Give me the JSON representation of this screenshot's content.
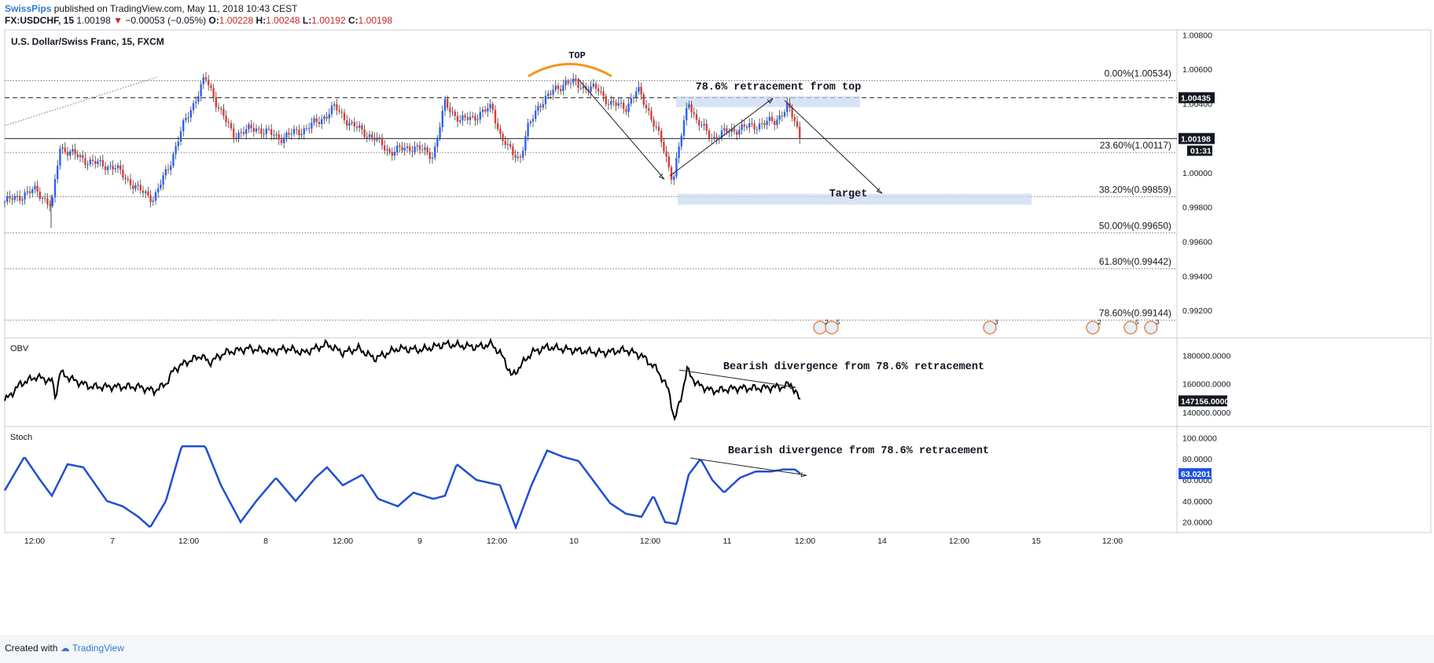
{
  "header": {
    "publisher": "SwissPips",
    "published_text": "published on TradingView.com, May 11, 2018 10:43 CEST",
    "symbol": "FX:USDCHF, 15",
    "last": "1.00198",
    "change": "−0.00053 (−0.05%)",
    "ohlc_label_o": "O:",
    "ohlc_o": "1.00228",
    "ohlc_label_h": "H:",
    "ohlc_h": "1.00248",
    "ohlc_label_l": "L:",
    "ohlc_l": "1.00192",
    "ohlc_label_c": "C:",
    "ohlc_c": "1.00198"
  },
  "footer": {
    "created_with": "Created with",
    "brand": "TradingView"
  },
  "colors": {
    "up": "#2962ff",
    "down": "#e53935",
    "obv": "#000000",
    "stoch": "#1f4fd1",
    "zone": "#c8d7f0",
    "top_arc": "#f7931e"
  },
  "chart_data": [
    {
      "type": "candlestick",
      "title": "U.S. Dollar/Swiss Franc, 15, FXCM",
      "ylim": [
        0.9905,
        1.0082
      ],
      "y_ticks": [
        "1.00800",
        "1.00600",
        "1.00400",
        "1.00200",
        "1.00000",
        "0.99800",
        "0.99600",
        "0.99400",
        "0.99200"
      ],
      "x_tick_labels": [
        "12:00",
        "7",
        "12:00",
        "8",
        "12:00",
        "9",
        "12:00",
        "10",
        "12:00",
        "11",
        "12:00",
        "14",
        "12:00",
        "15",
        "12:00"
      ],
      "price_path": [
        [
          0,
          0.9983
        ],
        [
          40,
          0.999
        ],
        [
          60,
          0.998
        ],
        [
          70,
          1.0015
        ],
        [
          90,
          1.001
        ],
        [
          110,
          1.0006
        ],
        [
          140,
          1.0003
        ],
        [
          170,
          0.999
        ],
        [
          190,
          0.9985
        ],
        [
          210,
          1.0005
        ],
        [
          225,
          1.0025
        ],
        [
          240,
          1.004
        ],
        [
          255,
          1.0055
        ],
        [
          270,
          1.004
        ],
        [
          290,
          1.0022
        ],
        [
          320,
          1.0026
        ],
        [
          350,
          1.002
        ],
        [
          380,
          1.0025
        ],
        [
          400,
          1.003
        ],
        [
          420,
          1.0038
        ],
        [
          440,
          1.0028
        ],
        [
          470,
          1.002
        ],
        [
          490,
          1.0012
        ],
        [
          520,
          1.0015
        ],
        [
          545,
          1.001
        ],
        [
          560,
          1.004
        ],
        [
          580,
          1.003
        ],
        [
          600,
          1.0033
        ],
        [
          620,
          1.0038
        ],
        [
          630,
          1.0022
        ],
        [
          640,
          1.0014
        ],
        [
          655,
          1.0008
        ],
        [
          665,
          1.0025
        ],
        [
          680,
          1.004
        ],
        [
          700,
          1.0048
        ],
        [
          715,
          1.0053
        ],
        [
          735,
          1.005
        ],
        [
          755,
          1.0048
        ],
        [
          770,
          1.004
        ],
        [
          790,
          1.0038
        ],
        [
          805,
          1.0048
        ],
        [
          820,
          1.0035
        ],
        [
          835,
          1.0018
        ],
        [
          850,
          0.9996
        ],
        [
          860,
          1.002
        ],
        [
          870,
          1.0042
        ],
        [
          880,
          1.003
        ],
        [
          900,
          1.002
        ],
        [
          920,
          1.0024
        ],
        [
          940,
          1.0026
        ],
        [
          960,
          1.0028
        ],
        [
          980,
          1.003
        ],
        [
          995,
          1.0038
        ],
        [
          1005,
          1.003
        ],
        [
          1012,
          1.002
        ]
      ],
      "last_price": "1.00198",
      "countdown": "01:31",
      "marked_level": "1.00435",
      "fibonacci": [
        {
          "label": "0.00%(1.00534)",
          "value": 1.00534
        },
        {
          "label": "23.60%(1.00117)",
          "value": 1.00117
        },
        {
          "label": "38.20%(0.99859)",
          "value": 0.99859
        },
        {
          "label": "50.00%(0.99650)",
          "value": 0.9965
        },
        {
          "label": "61.80%(0.99442)",
          "value": 0.99442
        },
        {
          "label": "78.60%(0.99144)",
          "value": 0.99144
        }
      ],
      "annotations": {
        "top": "TOP",
        "retracement": "78.6% retracement from top",
        "target": "Target"
      },
      "event_badges": [
        "2",
        "5",
        "3",
        "2",
        "5",
        "3"
      ]
    },
    {
      "type": "line",
      "title": "OBV",
      "ylim": [
        131000,
        192000
      ],
      "y_ticks": [
        "180000.0000",
        "160000.0000",
        "140000.0000"
      ],
      "series": [
        {
          "name": "OBV",
          "points": [
            [
              0,
              148000
            ],
            [
              20,
              160000
            ],
            [
              40,
              165000
            ],
            [
              60,
              162000
            ],
            [
              65,
              150000
            ],
            [
              70,
              168000
            ],
            [
              90,
              162000
            ],
            [
              110,
              158000
            ],
            [
              140,
              158000
            ],
            [
              170,
              158000
            ],
            [
              190,
              155000
            ],
            [
              205,
              160000
            ],
            [
              215,
              170000
            ],
            [
              230,
              175000
            ],
            [
              250,
              180000
            ],
            [
              260,
              175000
            ],
            [
              280,
              182000
            ],
            [
              310,
              185000
            ],
            [
              340,
              183000
            ],
            [
              360,
              185000
            ],
            [
              380,
              182000
            ],
            [
              410,
              188000
            ],
            [
              430,
              182000
            ],
            [
              450,
              185000
            ],
            [
              470,
              178000
            ],
            [
              480,
              180000
            ],
            [
              500,
              185000
            ],
            [
              530,
              184000
            ],
            [
              560,
              188000
            ],
            [
              600,
              186000
            ],
            [
              620,
              188000
            ],
            [
              635,
              178000
            ],
            [
              645,
              165000
            ],
            [
              655,
              172000
            ],
            [
              670,
              182000
            ],
            [
              690,
              186000
            ],
            [
              720,
              184000
            ],
            [
              760,
              182000
            ],
            [
              790,
              184000
            ],
            [
              810,
              180000
            ],
            [
              830,
              170000
            ],
            [
              845,
              155000
            ],
            [
              852,
              134000
            ],
            [
              860,
              150000
            ],
            [
              868,
              170000
            ],
            [
              880,
              160000
            ],
            [
              900,
              155000
            ],
            [
              930,
              157000
            ],
            [
              960,
              157000
            ],
            [
              990,
              158000
            ],
            [
              1000,
              160000
            ],
            [
              1012,
              148000
            ]
          ]
        }
      ],
      "last_value": "147156.0000",
      "annotation": "Bearish divergence from 78.6% retracement"
    },
    {
      "type": "line",
      "title": "Stoch",
      "ylim": [
        10,
        110
      ],
      "y_ticks": [
        "100.0000",
        "80.0000",
        "60.0000",
        "40.0000",
        "20.0000"
      ],
      "series": [
        {
          "name": "Stoch",
          "points": [
            [
              0,
              50
            ],
            [
              25,
              82
            ],
            [
              45,
              60
            ],
            [
              60,
              45
            ],
            [
              80,
              75
            ],
            [
              100,
              72
            ],
            [
              130,
              40
            ],
            [
              150,
              35
            ],
            [
              170,
              25
            ],
            [
              185,
              15
            ],
            [
              205,
              40
            ],
            [
              225,
              92
            ],
            [
              255,
              92
            ],
            [
              275,
              55
            ],
            [
              300,
              20
            ],
            [
              320,
              40
            ],
            [
              345,
              62
            ],
            [
              370,
              40
            ],
            [
              395,
              62
            ],
            [
              410,
              72
            ],
            [
              430,
              55
            ],
            [
              455,
              65
            ],
            [
              475,
              42
            ],
            [
              500,
              35
            ],
            [
              520,
              48
            ],
            [
              545,
              42
            ],
            [
              560,
              45
            ],
            [
              575,
              75
            ],
            [
              600,
              60
            ],
            [
              630,
              55
            ],
            [
              650,
              15
            ],
            [
              670,
              55
            ],
            [
              690,
              88
            ],
            [
              710,
              82
            ],
            [
              730,
              78
            ],
            [
              750,
              58
            ],
            [
              770,
              38
            ],
            [
              790,
              28
            ],
            [
              810,
              25
            ],
            [
              825,
              45
            ],
            [
              840,
              20
            ],
            [
              855,
              18
            ],
            [
              870,
              65
            ],
            [
              885,
              80
            ],
            [
              900,
              60
            ],
            [
              915,
              48
            ],
            [
              935,
              62
            ],
            [
              955,
              68
            ],
            [
              975,
              68
            ],
            [
              990,
              70
            ],
            [
              1005,
              70
            ],
            [
              1012,
              66
            ]
          ]
        }
      ],
      "last_value": "63.0201",
      "annotation": "Bearish divergence from 78.6% retracement"
    }
  ]
}
